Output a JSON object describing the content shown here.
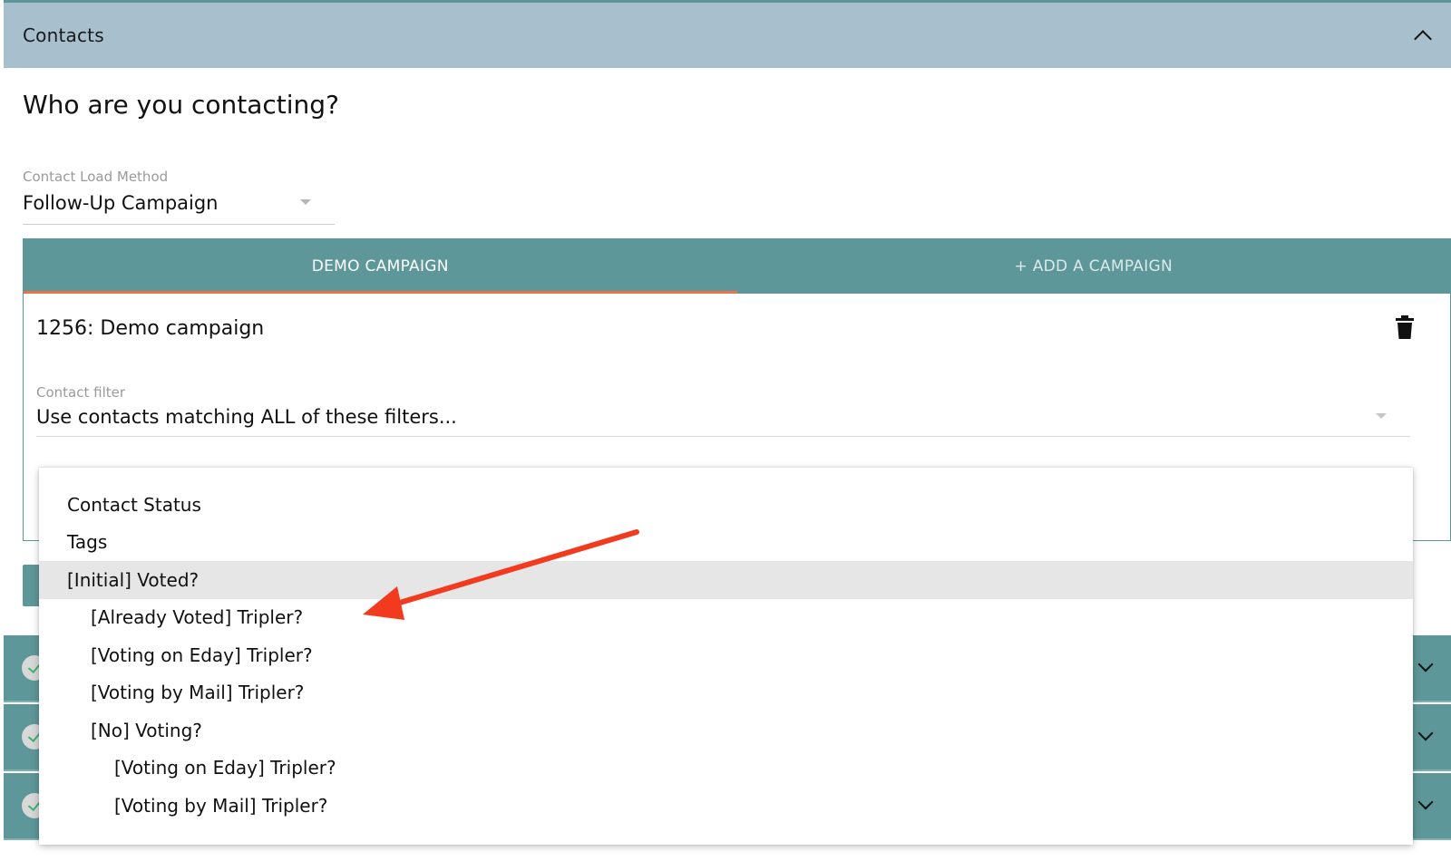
{
  "section": {
    "title": "Contacts"
  },
  "page_title": "Who are you contacting?",
  "load_method": {
    "label": "Contact Load Method",
    "value": "Follow-Up Campaign"
  },
  "tabs": [
    {
      "label": "DEMO CAMPAIGN",
      "active": true
    },
    {
      "label": "+ ADD A CAMPAIGN",
      "active": false
    }
  ],
  "campaign": {
    "name": "1256: Demo campaign"
  },
  "contact_filter": {
    "label": "Contact filter",
    "value": "Use contacts matching ALL of these filters..."
  },
  "dropdown_items": [
    {
      "label": "Contact Status",
      "level": 0,
      "highlighted": false
    },
    {
      "label": "Tags",
      "level": 0,
      "highlighted": false
    },
    {
      "label": "[Initial] Voted?",
      "level": 0,
      "highlighted": true
    },
    {
      "label": "[Already Voted] Tripler?",
      "level": 1,
      "highlighted": false
    },
    {
      "label": "[Voting on Eday] Tripler?",
      "level": 1,
      "highlighted": false
    },
    {
      "label": "[Voting by Mail] Tripler?",
      "level": 1,
      "highlighted": false
    },
    {
      "label": "[No] Voting?",
      "level": 1,
      "highlighted": false
    },
    {
      "label": "[Voting on Eday] Tripler?",
      "level": 2,
      "highlighted": false
    },
    {
      "label": "[Voting by Mail] Tripler?",
      "level": 2,
      "highlighted": false
    }
  ],
  "colors": {
    "header_bg": "#a8bfcd",
    "teal": "#5e9799",
    "tab_indicator": "#e8744a",
    "highlight": "#e6e6e6",
    "annotation_arrow": "#f23a1f"
  },
  "icons": [
    "chevron-up-icon",
    "trash-icon",
    "check-icon",
    "chevron-down-icon",
    "arrow-annotation"
  ]
}
